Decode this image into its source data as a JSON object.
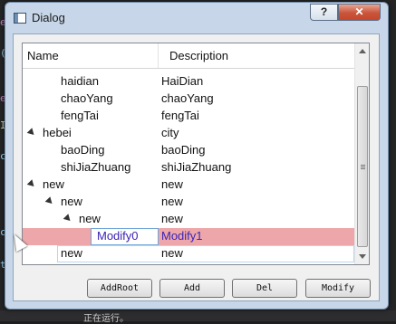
{
  "window": {
    "title": "Dialog",
    "help_label": "?",
    "close_label": "✕"
  },
  "tree": {
    "columns": [
      "Name",
      "Description"
    ],
    "rows": [
      {
        "name": "haidian",
        "desc": "HaiDian"
      },
      {
        "name": "chaoYang",
        "desc": "chaoYang"
      },
      {
        "name": "fengTai",
        "desc": "fengTai"
      },
      {
        "name": "hebei",
        "desc": "city"
      },
      {
        "name": "baoDing",
        "desc": "baoDing"
      },
      {
        "name": "shiJiaZhuang",
        "desc": "shiJiaZhuang"
      },
      {
        "name": "new",
        "desc": "new"
      },
      {
        "name": "new",
        "desc": "new"
      },
      {
        "name": "new",
        "desc": "new"
      },
      {
        "name": "Modify0",
        "desc": "Modify1"
      },
      {
        "name": "new",
        "desc": "new"
      }
    ]
  },
  "buttons": {
    "add_root": "AddRoot",
    "add": "Add",
    "del": "Del",
    "modify": "Modify"
  },
  "background": {
    "status_text": "正在运行。"
  }
}
